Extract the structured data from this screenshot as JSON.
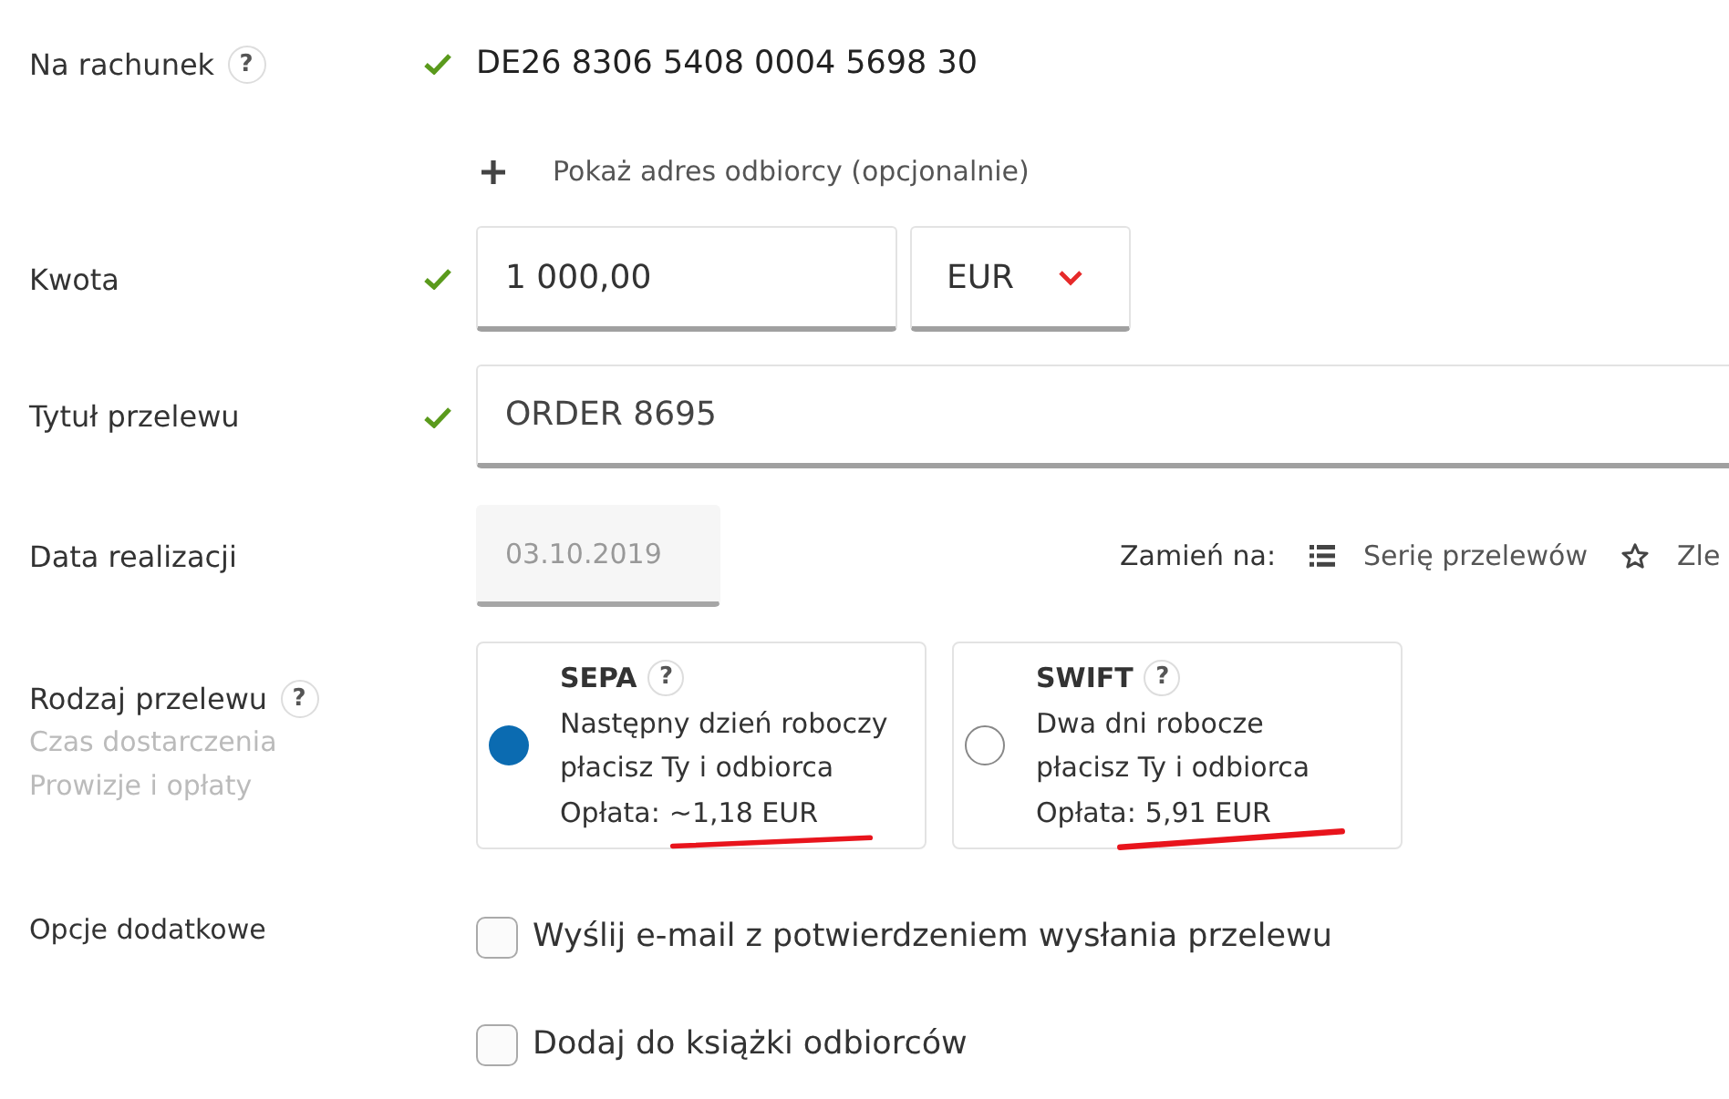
{
  "recipient_account": {
    "label": "Na rachunek",
    "help": "?",
    "valid": true,
    "value": "DE26 8306 5408 0004 5698 30"
  },
  "show_address_link": {
    "label": "Pokaż adres odbiorcy (opcjonalnie)"
  },
  "amount": {
    "label": "Kwota",
    "valid": true,
    "value": "1 000,00",
    "currency": "EUR"
  },
  "transfer_title": {
    "label": "Tytuł przelewu",
    "valid": true,
    "value": "ORDER 8695"
  },
  "execution_date": {
    "label": "Data realizacji",
    "value": "03.10.2019",
    "disabled": true
  },
  "convert_to": {
    "label": "Zamień na:",
    "options": [
      {
        "label": "Serię przelewów"
      },
      {
        "label": "Zle"
      }
    ]
  },
  "transfer_type": {
    "label": "Rodzaj przelewu",
    "help": "?",
    "hints": [
      "Czas dostarczenia",
      "Prowizje i opłaty"
    ],
    "options": [
      {
        "name": "SEPA",
        "help": "?",
        "delivery": "Następny dzień roboczy",
        "payer": "płacisz Ty i odbiorca",
        "fee_label": "Opłata:",
        "fee": "~1,18 EUR",
        "selected": true,
        "underlined": true
      },
      {
        "name": "SWIFT",
        "help": "?",
        "delivery": "Dwa dni robocze",
        "payer": "płacisz Ty i odbiorca",
        "fee_label": "Opłata:",
        "fee": "5,91 EUR",
        "selected": false,
        "underlined": true
      }
    ]
  },
  "additional_options": {
    "label": "Opcje dodatkowe",
    "options": [
      {
        "label": "Wyślij e-mail z potwierdzeniem wysłania przelewu",
        "checked": false
      },
      {
        "label": "Dodaj do książki odbiorców",
        "checked": false
      }
    ]
  }
}
